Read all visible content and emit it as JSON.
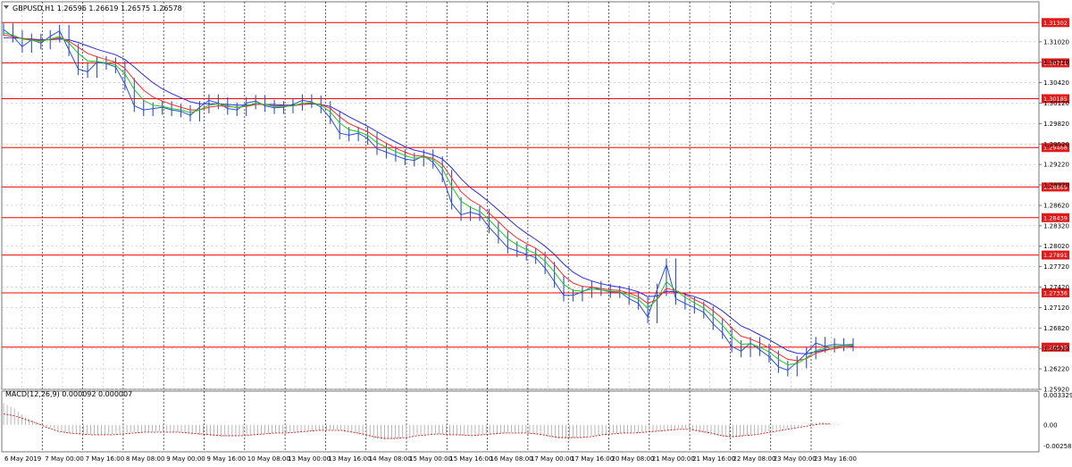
{
  "header": {
    "symbol_line": "GBPUSD,H1  1.26596 1.26619 1.26575 1.26578"
  },
  "macd": {
    "label": "MACD(12,26,9) 0.000092 0.000007",
    "top_label": "0.003329",
    "zero_label": "0.00",
    "bottom_label": "-0.002585",
    "ylim": [
      -0.002585,
      0.003329
    ],
    "histogram": [
      0.0024,
      0.0018,
      0.0008,
      0.0003,
      -0.0002,
      -0.0006,
      -0.0009,
      -0.001,
      -0.0011,
      -0.0011,
      -0.001,
      -0.0009,
      -0.0008,
      -0.0008,
      -0.0007,
      -0.0007,
      -0.0008,
      -0.0009,
      -0.0011,
      -0.0012,
      -0.0013,
      -0.0013,
      -0.0012,
      -0.0011,
      -0.001,
      -0.0009,
      -0.0008,
      -0.0008,
      -0.0007,
      -0.0006,
      -0.0005,
      -0.0006,
      -0.0008,
      -0.0012,
      -0.0015,
      -0.0016,
      -0.0015,
      -0.0013,
      -0.0011,
      -0.001,
      -0.001,
      -0.0011,
      -0.0012,
      -0.0012,
      -0.0011,
      -0.001,
      -0.0009,
      -0.0008,
      -0.0009,
      -0.0011,
      -0.0013,
      -0.0015,
      -0.0015,
      -0.0014,
      -0.0012,
      -0.0011,
      -0.001,
      -0.0009,
      -0.0008,
      -0.0008,
      -0.0007,
      -0.0006,
      -0.0004,
      -0.0005,
      -0.0008,
      -0.0011,
      -0.0013,
      -0.0014,
      -0.0012,
      -0.001,
      -0.0008,
      -0.0006,
      -0.0004,
      -0.0002,
      0.0001,
      0.0003,
      0.0001
    ],
    "signal": [
      0.0012,
      0.001,
      0.0006,
      0.0002,
      -0.0003,
      -0.0007,
      -0.0009,
      -0.001,
      -0.0011,
      -0.0011,
      -0.0011,
      -0.001,
      -0.0009,
      -0.0008,
      -0.0008,
      -0.0008,
      -0.0008,
      -0.0009,
      -0.001,
      -0.0011,
      -0.0012,
      -0.0012,
      -0.0012,
      -0.0011,
      -0.001,
      -0.0009,
      -0.0009,
      -0.0008,
      -0.0007,
      -0.0006,
      -0.0006,
      -0.0006,
      -0.0008,
      -0.001,
      -0.0013,
      -0.0015,
      -0.0015,
      -0.0014,
      -0.0012,
      -0.0011,
      -0.001,
      -0.0011,
      -0.0011,
      -0.0012,
      -0.0011,
      -0.001,
      -0.0009,
      -0.0009,
      -0.0009,
      -0.001,
      -0.0012,
      -0.0014,
      -0.0014,
      -0.0014,
      -0.0013,
      -0.0011,
      -0.001,
      -0.0009,
      -0.0009,
      -0.0008,
      -0.0007,
      -0.0006,
      -0.0005,
      -0.0005,
      -0.0007,
      -0.0009,
      -0.0012,
      -0.0013,
      -0.0012,
      -0.0011,
      -0.0009,
      -0.0007,
      -0.0005,
      -0.0003,
      -0.0001,
      0.0001,
      0.0001
    ]
  },
  "chart_data": {
    "type": "line",
    "title": "GBPUSD,H1",
    "ylim": [
      1.2592,
      1.3145
    ],
    "y_ticks": [
      "1.31020",
      "1.30720",
      "1.30420",
      "1.30120",
      "1.29820",
      "1.29520",
      "1.29220",
      "1.28920",
      "1.28620",
      "1.28320",
      "1.28020",
      "1.27720",
      "1.27420",
      "1.27120",
      "1.26820",
      "1.26520",
      "1.26220",
      "1.25920"
    ],
    "x_ticks": [
      "6 May 2019",
      "7 May 00:00",
      "7 May 16:00",
      "8 May 08:00",
      "9 May 00:00",
      "9 May 16:00",
      "10 May 08:00",
      "13 May 00:00",
      "13 May 16:00",
      "14 May 08:00",
      "15 May 00:00",
      "15 May 16:00",
      "16 May 08:00",
      "17 May 00:00",
      "17 May 16:00",
      "20 May 08:00",
      "21 May 00:00",
      "21 May 16:00",
      "22 May 08:00",
      "23 May 00:00",
      "23 May 16:00"
    ],
    "levels": [
      {
        "value": 1.31302,
        "label": "1.31302"
      },
      {
        "value": 1.30711,
        "label": "1.30711"
      },
      {
        "value": 1.30185,
        "label": "1.30185"
      },
      {
        "value": 1.29468,
        "label": "1.29468"
      },
      {
        "value": 1.28889,
        "label": "1.28889"
      },
      {
        "value": 1.28439,
        "label": "1.28439"
      },
      {
        "value": 1.27891,
        "label": "1.27891"
      },
      {
        "value": 1.27336,
        "label": "1.27336"
      },
      {
        "value": 1.26539,
        "label": "1.26539"
      }
    ],
    "price": [
      1.312,
      1.311,
      1.3095,
      1.3105,
      1.31,
      1.311,
      1.3118,
      1.309,
      1.3062,
      1.3058,
      1.3072,
      1.307,
      1.3065,
      1.304,
      1.3008,
      1.3002,
      1.3004,
      1.3006,
      1.3002,
      1.3,
      1.2994,
      1.3006,
      1.3016,
      1.3012,
      1.3004,
      1.3002,
      1.3012,
      1.3015,
      1.3008,
      1.3005,
      1.3006,
      1.301,
      1.3016,
      1.3014,
      1.3006,
      1.299,
      1.2968,
      1.2965,
      1.2968,
      1.296,
      1.2945,
      1.294,
      1.2935,
      1.293,
      1.2928,
      1.2935,
      1.2925,
      1.2905,
      1.2865,
      1.2848,
      1.2852,
      1.2848,
      1.283,
      1.2815,
      1.28,
      1.2795,
      1.279,
      1.2785,
      1.277,
      1.275,
      1.273,
      1.273,
      1.2735,
      1.2742,
      1.2738,
      1.2735,
      1.2735,
      1.2725,
      1.2718,
      1.2698,
      1.2738,
      1.2775,
      1.2725,
      1.2718,
      1.2712,
      1.2705,
      1.2688,
      1.2675,
      1.2655,
      1.2648,
      1.266,
      1.265,
      1.264,
      1.2625,
      1.262,
      1.2632,
      1.2645,
      1.266,
      1.2655,
      1.2658,
      1.2657,
      1.2658
    ],
    "ma_fast": [
      1.3115,
      1.3112,
      1.3106,
      1.3104,
      1.3103,
      1.3106,
      1.311,
      1.31,
      1.3085,
      1.3074,
      1.3073,
      1.3071,
      1.3068,
      1.3055,
      1.3032,
      1.3016,
      1.3009,
      1.3007,
      1.3004,
      1.3002,
      1.2998,
      1.3002,
      1.3009,
      1.3011,
      1.3008,
      1.3005,
      1.3008,
      1.3012,
      1.301,
      1.3007,
      1.3007,
      1.3008,
      1.3012,
      1.3013,
      1.3009,
      1.2999,
      1.2983,
      1.2973,
      1.297,
      1.2965,
      1.2954,
      1.2947,
      1.2941,
      1.2935,
      1.2931,
      1.2933,
      1.2929,
      1.2916,
      1.289,
      1.2868,
      1.2859,
      1.2853,
      1.2841,
      1.2827,
      1.2813,
      1.2804,
      1.2797,
      1.2791,
      1.278,
      1.2764,
      1.2746,
      1.2737,
      1.2736,
      1.2739,
      1.2738,
      1.2736,
      1.2735,
      1.273,
      1.2724,
      1.2711,
      1.2724,
      1.275,
      1.2737,
      1.2727,
      1.2719,
      1.2711,
      1.2699,
      1.2686,
      1.267,
      1.2658,
      1.2659,
      1.2654,
      1.2647,
      1.2636,
      1.2628,
      1.263,
      1.2638,
      1.2649,
      1.2652,
      1.2655,
      1.2656,
      1.2657
    ],
    "ma_mid": [
      1.3112,
      1.311,
      1.3107,
      1.3105,
      1.3104,
      1.3105,
      1.3108,
      1.3103,
      1.3094,
      1.3085,
      1.308,
      1.3076,
      1.3072,
      1.3063,
      1.3046,
      1.3031,
      1.3021,
      1.3015,
      1.301,
      1.3006,
      1.3002,
      1.3002,
      1.3006,
      1.3008,
      1.3007,
      1.3006,
      1.3007,
      1.301,
      1.301,
      1.3008,
      1.3008,
      1.3008,
      1.301,
      1.3012,
      1.301,
      1.3004,
      1.2992,
      1.2982,
      1.2976,
      1.297,
      1.2961,
      1.2953,
      1.2946,
      1.294,
      1.2935,
      1.2934,
      1.2931,
      1.2922,
      1.2902,
      1.2882,
      1.287,
      1.2862,
      1.2851,
      1.2838,
      1.2825,
      1.2814,
      1.2806,
      1.2799,
      1.2789,
      1.2775,
      1.2759,
      1.2748,
      1.2743,
      1.2742,
      1.274,
      1.2738,
      1.2737,
      1.2733,
      1.2728,
      1.2718,
      1.2724,
      1.274,
      1.2737,
      1.2731,
      1.2724,
      1.2717,
      1.2707,
      1.2696,
      1.2682,
      1.267,
      1.2666,
      1.266,
      1.2653,
      1.2644,
      1.2636,
      1.2634,
      1.2637,
      1.2645,
      1.2649,
      1.2652,
      1.2654,
      1.2656
    ],
    "ma_slow": [
      1.3108,
      1.3108,
      1.3107,
      1.3106,
      1.3105,
      1.3105,
      1.3106,
      1.3105,
      1.3101,
      1.3096,
      1.3091,
      1.3087,
      1.3083,
      1.3076,
      1.3065,
      1.3053,
      1.3042,
      1.3033,
      1.3026,
      1.302,
      1.3014,
      1.3011,
      1.3011,
      1.3011,
      1.301,
      1.3009,
      1.3009,
      1.301,
      1.301,
      1.301,
      1.3009,
      1.3009,
      1.301,
      1.3011,
      1.301,
      1.3007,
      1.3,
      1.2992,
      1.2985,
      1.2978,
      1.297,
      1.2962,
      1.2955,
      1.2948,
      1.2943,
      1.294,
      1.2936,
      1.293,
      1.2917,
      1.2901,
      1.2888,
      1.2878,
      1.2867,
      1.2855,
      1.2843,
      1.2831,
      1.2821,
      1.2812,
      1.2802,
      1.279,
      1.2776,
      1.2764,
      1.2756,
      1.2751,
      1.2747,
      1.2744,
      1.2742,
      1.2739,
      1.2735,
      1.2728,
      1.2729,
      1.2736,
      1.2735,
      1.2732,
      1.2728,
      1.2723,
      1.2716,
      1.2707,
      1.2696,
      1.2685,
      1.2679,
      1.2672,
      1.2665,
      1.2657,
      1.2649,
      1.2645,
      1.2644,
      1.2647,
      1.265,
      1.2652,
      1.2654,
      1.2655
    ]
  },
  "colors": {
    "price": "#2b4fd8",
    "ma_fast": "#19c919",
    "ma_mid": "#ff2a2a",
    "ma_slow": "#2a2ae0",
    "level": "#ff0000",
    "level_badge": "#e01a1a",
    "grid": "#b8b8b8",
    "macd_hist": "#9a9a9a",
    "macd_signal": "#d81818"
  }
}
